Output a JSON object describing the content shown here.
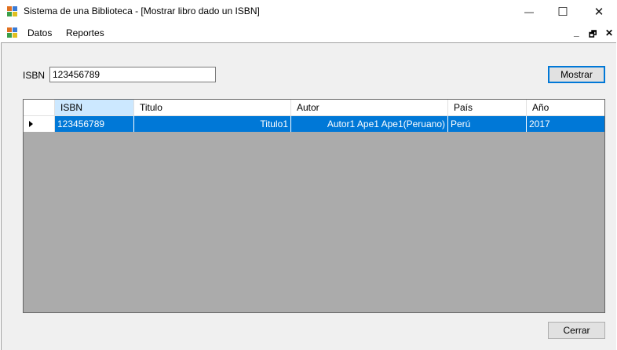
{
  "window": {
    "title": "Sistema de una Biblioteca - [Mostrar libro dado un ISBN]",
    "app_icon": "app-icon",
    "controls": {
      "minimize": "—",
      "maximize": "☐",
      "close": "✕"
    }
  },
  "menubar": {
    "items": [
      "Datos",
      "Reportes"
    ],
    "mdi_controls": {
      "minimize": "_",
      "restore": "🗗",
      "close": "✕"
    }
  },
  "form": {
    "isbn_label": "ISBN",
    "isbn_value": "123456789",
    "mostrar_label": "Mostrar",
    "cerrar_label": "Cerrar"
  },
  "grid": {
    "columns": [
      "ISBN",
      "Titulo",
      "Autor",
      "País",
      "Año"
    ],
    "rows": [
      [
        "123456789",
        "Titulo1",
        "Autor1 Ape1 Ape1(Peruano)",
        "Perú",
        "2017"
      ]
    ],
    "selection_color": "#0078d7",
    "header_highlight": "#cce8ff"
  }
}
